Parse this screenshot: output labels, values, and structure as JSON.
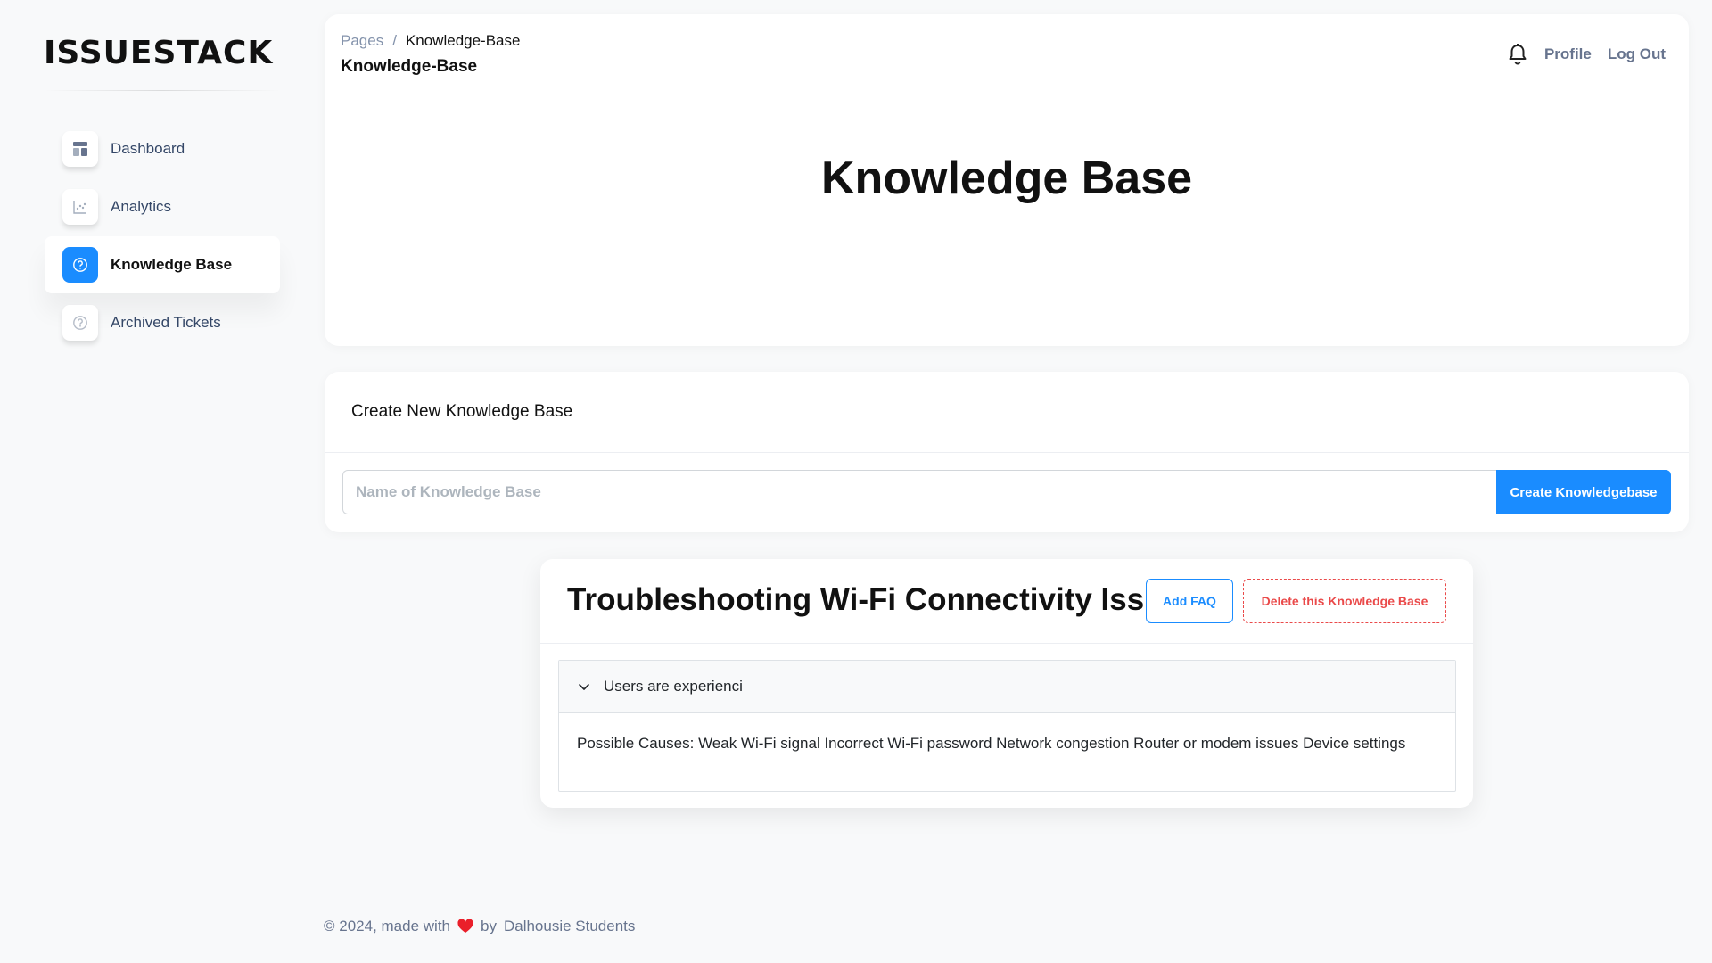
{
  "app": {
    "logo_text": "ISSUESTACK",
    "brand_color": "#1a8cff"
  },
  "sidebar": {
    "items": [
      {
        "label": "Dashboard",
        "icon": "dashboard-icon",
        "active": false
      },
      {
        "label": "Analytics",
        "icon": "chart-icon",
        "active": false
      },
      {
        "label": "Knowledge Base",
        "icon": "question-circle-icon",
        "active": true
      },
      {
        "label": "Archived Tickets",
        "icon": "question-circle-icon",
        "active": false
      }
    ]
  },
  "header": {
    "breadcrumb_root": "Pages",
    "breadcrumb_separator": "/",
    "breadcrumb_current": "Knowledge-Base",
    "subtitle": "Knowledge-Base",
    "profile_label": "Profile",
    "logout_label": "Log Out",
    "title": "Knowledge Base"
  },
  "create": {
    "title": "Create New Knowledge Base",
    "input_placeholder": "Name of Knowledge Base",
    "input_value": "",
    "button_label": "Create Knowledgebase"
  },
  "knowledge_base": {
    "title": "Troubleshooting Wi-Fi Connectivity Issues",
    "add_faq_label": "Add FAQ",
    "delete_label": "Delete this Knowledge Base",
    "faq": {
      "question": "Users are experienci",
      "answer": "Possible Causes: Weak Wi-Fi signal Incorrect Wi-Fi password Network congestion Router or modem issues Device settings",
      "expanded": true
    }
  },
  "footer": {
    "prefix": "© 2024, made with",
    "by": "by",
    "author": "Dalhousie Students",
    "heart_color": "#ea1f2a"
  }
}
